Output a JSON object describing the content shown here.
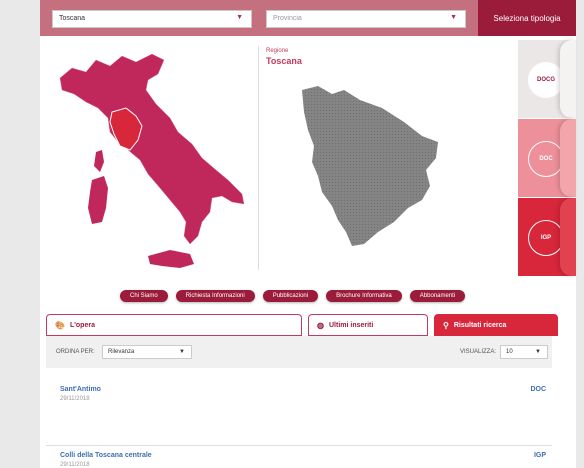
{
  "filters": {
    "region_value": "Toscana",
    "province_placeholder": "Provincia",
    "tipologia_label": "Seleziona tipologia"
  },
  "region": {
    "label": "Regione",
    "name": "Toscana"
  },
  "typologies": [
    {
      "label": "DOCG"
    },
    {
      "label": "DOC"
    },
    {
      "label": "IGP"
    }
  ],
  "nav": [
    "Chi Siamo",
    "Richiesta Informazioni",
    "Pubblicazioni",
    "Brochure Informativa",
    "Abbonamenti"
  ],
  "tabs": [
    {
      "label": "L'opera"
    },
    {
      "label": "Ultimi inseriti"
    },
    {
      "label": "Risultati ricerca"
    }
  ],
  "sort": {
    "label": "ORDINA PER:",
    "value": "Rilevanza"
  },
  "display": {
    "label": "VISUALIZZA:",
    "value": "10"
  },
  "results": [
    {
      "name": "Sant'Antimo",
      "date": "29/11/2018",
      "type": "DOC"
    },
    {
      "name": "Colli della Toscana centrale",
      "date": "29/11/2018",
      "type": "IGP"
    }
  ],
  "colors": {
    "brand": "#9b1b3a",
    "accent": "#d8263a",
    "map_italy": "#c0275a",
    "map_selected": "#d8263a",
    "map_region": "#808080",
    "link": "#3d6fb0"
  }
}
